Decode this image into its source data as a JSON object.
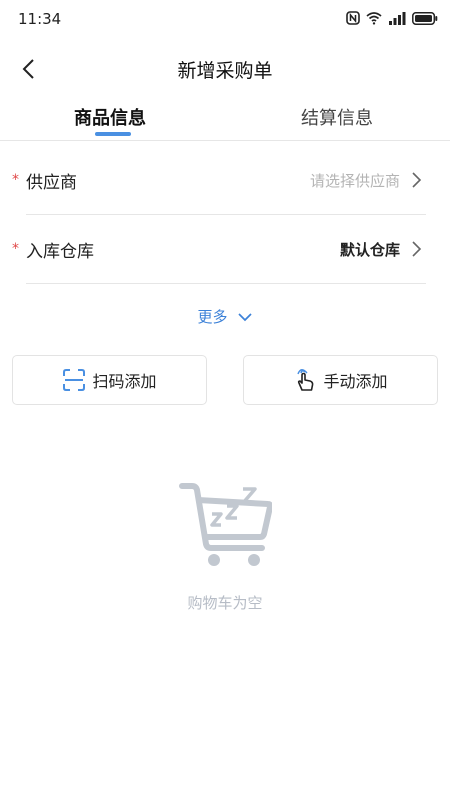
{
  "status_bar": {
    "time": "11:34"
  },
  "header": {
    "title": "新增采购单"
  },
  "tabs": [
    {
      "label": "商品信息",
      "active": true
    },
    {
      "label": "结算信息",
      "active": false
    }
  ],
  "form": {
    "supplier": {
      "required_mark": "*",
      "label": "供应商",
      "placeholder": "请选择供应商"
    },
    "warehouse": {
      "required_mark": "*",
      "label": "入库仓库",
      "value": "默认仓库"
    }
  },
  "more_label": "更多",
  "actions": {
    "scan_label": "扫码添加",
    "manual_label": "手动添加"
  },
  "empty_cart": {
    "text": "购物车为空",
    "icon": "sleeping-cart-icon"
  },
  "colors": {
    "accent": "#4a90e2",
    "required": "#e04848",
    "placeholder": "#b4b4b4"
  }
}
